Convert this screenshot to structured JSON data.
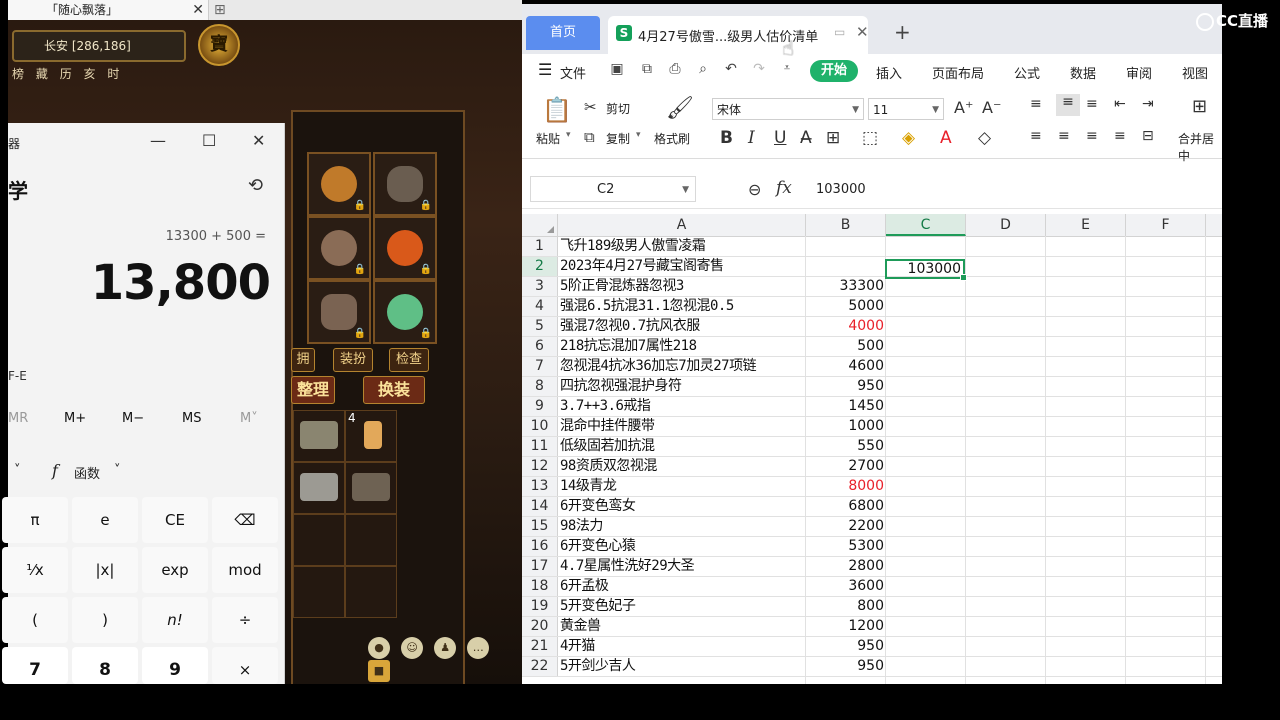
{
  "game": {
    "tab_title": "「随心飘落」",
    "location": "长安 [286,186]",
    "menu_strip": [
      "榜",
      "藏",
      "历",
      "亥",
      "时"
    ],
    "badge": "寶",
    "buttons": {
      "small1": "拥",
      "small2": "装扮",
      "small3": "检查",
      "sort": "整理",
      "swap": "换装"
    },
    "bag_count": "4"
  },
  "calculator": {
    "title": "器",
    "mode": "学",
    "expression": "13300 + 500 =",
    "result": "13,800",
    "angle_label": "F-E",
    "memory": [
      "MR",
      "M+",
      "M−",
      "MS",
      "M˅"
    ],
    "func_label": "函数",
    "keys": [
      [
        "π",
        "e",
        "CE",
        "⌫"
      ],
      [
        "¹⁄x",
        "|x|",
        "exp",
        "mod"
      ],
      [
        "(",
        ")",
        "n!",
        "÷"
      ],
      [
        "7",
        "8",
        "9",
        "×"
      ]
    ]
  },
  "wps": {
    "tabs": {
      "home": "首页",
      "doc": "4月27号傲雪...级男人估价清单",
      "doc_icon": "S"
    },
    "menu": {
      "file": "文件",
      "items": [
        "开始",
        "插入",
        "页面布局",
        "公式",
        "数据",
        "审阅",
        "视图"
      ]
    },
    "ribbon": {
      "paste": "粘贴",
      "cut": "剪切",
      "copy": "复制",
      "format_painter": "格式刷",
      "font_name": "宋体",
      "font_size": "11",
      "merge": "合并居中"
    },
    "formula_bar": {
      "name_box": "C2",
      "fx": "fx",
      "value": "103000"
    },
    "columns": [
      "A",
      "B",
      "C",
      "D",
      "E",
      "F"
    ],
    "selected_column": "C",
    "selected_row": "2",
    "active_cell_value": "103000",
    "rows": [
      {
        "n": "1",
        "a": "飞升189级男人傲雪凌霜",
        "b": ""
      },
      {
        "n": "2",
        "a": "2023年4月27号藏宝阁寄售",
        "b": ""
      },
      {
        "n": "3",
        "a": "5阶正骨混炼器忽视3",
        "b": "33300"
      },
      {
        "n": "4",
        "a": "强混6.5抗混31.1忽视混0.5",
        "b": "5000"
      },
      {
        "n": "5",
        "a": "强混7忽视0.7抗风衣服",
        "b": "4000",
        "red": true
      },
      {
        "n": "6",
        "a": "218抗忘混加7属性218",
        "b": "500"
      },
      {
        "n": "7",
        "a": "忽视混4抗冰36加忘7加灵27项链",
        "b": "4600"
      },
      {
        "n": "8",
        "a": "四抗忽视强混护身符",
        "b": "950"
      },
      {
        "n": "9",
        "a": "3.7++3.6戒指",
        "b": "1450"
      },
      {
        "n": "10",
        "a": "混命中挂件腰带",
        "b": "1000"
      },
      {
        "n": "11",
        "a": "低级固若加抗混",
        "b": "550"
      },
      {
        "n": "12",
        "a": "98资质双忽视混",
        "b": "2700"
      },
      {
        "n": "13",
        "a": "14级青龙",
        "b": "8000",
        "red": true
      },
      {
        "n": "14",
        "a": "6开变色鸾女",
        "b": "6800"
      },
      {
        "n": "15",
        "a": "98法力",
        "b": "2200"
      },
      {
        "n": "16",
        "a": "6开变色心猿",
        "b": "5300"
      },
      {
        "n": "17",
        "a": "4.7星属性洗好29大圣",
        "b": "2800"
      },
      {
        "n": "18",
        "a": "6开孟极",
        "b": "3600"
      },
      {
        "n": "19",
        "a": "5开变色妃子",
        "b": "800"
      },
      {
        "n": "20",
        "a": "黄金兽",
        "b": "1200"
      },
      {
        "n": "21",
        "a": "4开猫",
        "b": "950"
      },
      {
        "n": "22",
        "a": "5开剑少吉人",
        "b": "950"
      }
    ]
  },
  "watermark": "CC直播",
  "colors": {
    "accent_green": "#1e9b59",
    "tab_blue": "#5b8def",
    "red_value": "#e8202a"
  }
}
